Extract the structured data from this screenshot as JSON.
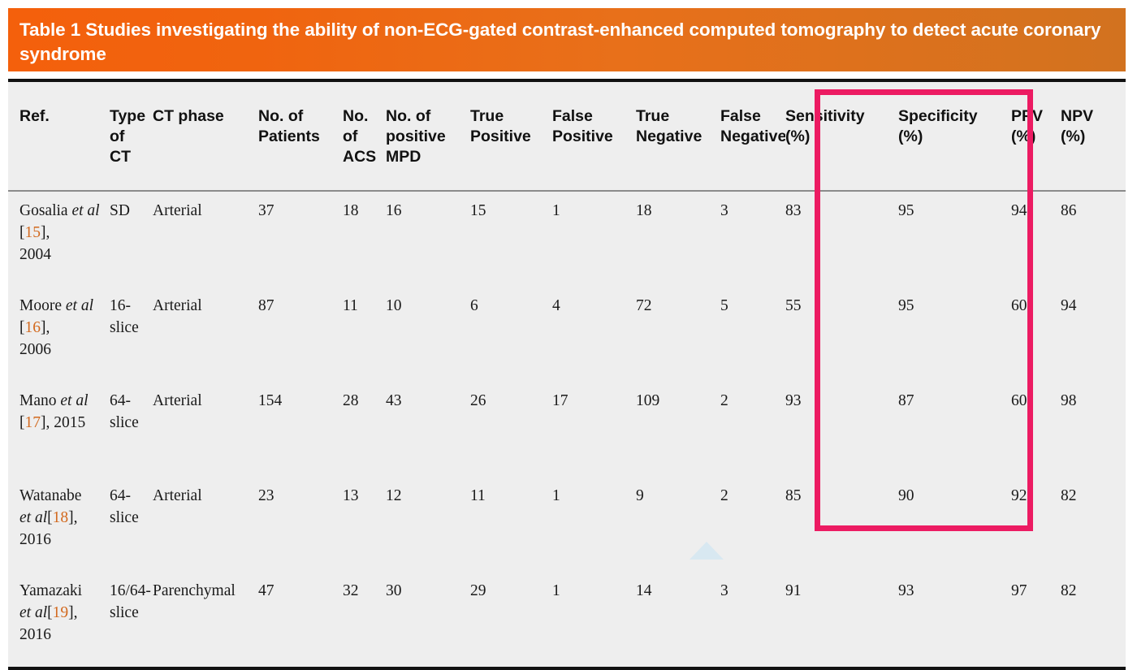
{
  "caption": {
    "text": "Table 1 Studies investigating the ability of non-ECG-gated contrast-enhanced computed tomography to detect acute coronary syndrome",
    "banner_color_start": "#f4600c",
    "banner_color_end": "#d2721f",
    "text_color": "#ffffff"
  },
  "highlight": {
    "color": "#ec1b62",
    "columns": [
      "Sensitivity (%)",
      "Specificity (%)"
    ]
  },
  "table": {
    "headers": [
      "Ref.",
      "Type of CT",
      "CT phase",
      "No. of Patients",
      "No. of ACS",
      "No. of positive MPD",
      "True Positive",
      "False Positive",
      "True Negative",
      "False Negative",
      "Sensitivity (%)",
      "Specificity (%)",
      "PPV (%)",
      "NPV (%)"
    ],
    "header_lines": [
      [
        "Ref."
      ],
      [
        "Type",
        "of CT"
      ],
      [
        "CT phase"
      ],
      [
        "No. of",
        "Patients"
      ],
      [
        "No.",
        "of",
        "ACS"
      ],
      [
        "No. of",
        "positive",
        "MPD"
      ],
      [
        "True",
        "Positive"
      ],
      [
        "False",
        "Positive"
      ],
      [
        "True",
        "Negative"
      ],
      [
        "False",
        "Negative"
      ],
      [
        "Sensitivity",
        "(%)"
      ],
      [
        "Specificity",
        "(%)"
      ],
      [
        "PPV",
        "(%)"
      ],
      [
        "NPV",
        "(%)"
      ]
    ],
    "rows": [
      {
        "ref_author": "Gosalia",
        "ref_etal": "et al",
        "ref_number": "15",
        "ref_year": "2004",
        "ref_layout": "author-etal-ref-year",
        "type_of_ct": "SD",
        "ct_phase": "Arterial",
        "no_of_patients": "37",
        "no_of_acs": "18",
        "no_positive_mpd": "16",
        "true_positive": "15",
        "false_positive": "1",
        "true_negative": "18",
        "false_negative": "3",
        "sensitivity": "83",
        "specificity": "95",
        "ppv": "94",
        "npv": "86"
      },
      {
        "ref_author": "Moore",
        "ref_etal": "et al",
        "ref_number": "16",
        "ref_year": "2006",
        "ref_layout": "author-etal-ref-year",
        "type_of_ct": "16-slice",
        "ct_phase": "Arterial",
        "no_of_patients": "87",
        "no_of_acs": "11",
        "no_positive_mpd": "10",
        "true_positive": "6",
        "false_positive": "4",
        "true_negative": "72",
        "false_negative": "5",
        "sensitivity": "55",
        "specificity": "95",
        "ppv": "60",
        "npv": "94"
      },
      {
        "ref_author": "Mano",
        "ref_etal": "et al",
        "ref_number": "17",
        "ref_year": "2015",
        "ref_layout": "author-etal-break-ref-year",
        "type_of_ct": "64-slice",
        "ct_phase": "Arterial",
        "no_of_patients": "154",
        "no_of_acs": "28",
        "no_positive_mpd": "43",
        "true_positive": "26",
        "false_positive": "17",
        "true_negative": "109",
        "false_negative": "2",
        "sensitivity": "93",
        "specificity": "87",
        "ppv": "60",
        "npv": "98"
      },
      {
        "ref_author": "Watanabe",
        "ref_etal": "et al",
        "ref_number": "18",
        "ref_year": "2016",
        "ref_layout": "author-break-etal-ref-year",
        "type_of_ct": "64-slice",
        "ct_phase": "Arterial",
        "no_of_patients": "23",
        "no_of_acs": "13",
        "no_positive_mpd": "12",
        "true_positive": "11",
        "false_positive": "1",
        "true_negative": "9",
        "false_negative": "2",
        "sensitivity": "85",
        "specificity": "90",
        "ppv": "92",
        "npv": "82"
      },
      {
        "ref_author": "Yamazaki",
        "ref_etal": "et al",
        "ref_number": "19",
        "ref_year": "2016",
        "ref_layout": "author-break-etal-ref-year",
        "type_of_ct": "16/64-slice",
        "ct_phase": "Parenchymal",
        "no_of_patients": "47",
        "no_of_acs": "32",
        "no_positive_mpd": "30",
        "true_positive": "29",
        "false_positive": "1",
        "true_negative": "14",
        "false_negative": "3",
        "sensitivity": "91",
        "specificity": "93",
        "ppv": "97",
        "npv": "82"
      }
    ]
  }
}
